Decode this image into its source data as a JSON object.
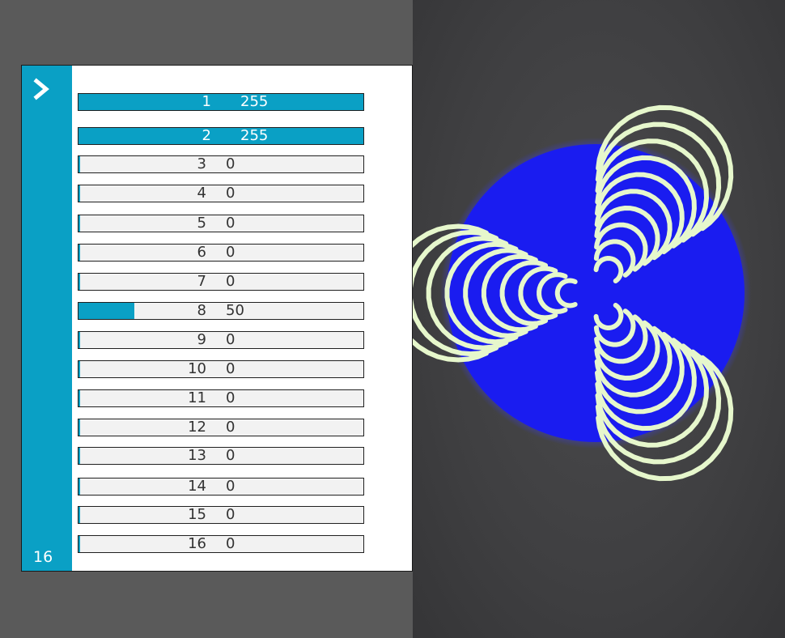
{
  "controls": {
    "expand_icon": "chevron-right-icon",
    "channel_count": "16"
  },
  "colors": {
    "accent": "#0aa0c5",
    "track": "#f2f2f2",
    "projection_blue": "#1a1cf0",
    "projection_lines": "#e6f7cc"
  },
  "channels": [
    {
      "label": "1",
      "value": "255",
      "level": 1.0
    },
    {
      "label": "2",
      "value": "255",
      "level": 1.0
    },
    {
      "label": "3",
      "value": "0",
      "level": 0
    },
    {
      "label": "4",
      "value": "0",
      "level": 0
    },
    {
      "label": "5",
      "value": "0",
      "level": 0
    },
    {
      "label": "6",
      "value": "0",
      "level": 0
    },
    {
      "label": "7",
      "value": "0",
      "level": 0
    },
    {
      "label": "8",
      "value": "50",
      "level": 0.196
    },
    {
      "label": "9",
      "value": "0",
      "level": 0
    },
    {
      "label": "10",
      "value": "0",
      "level": 0
    },
    {
      "label": "11",
      "value": "0",
      "level": 0
    },
    {
      "label": "12",
      "value": "0",
      "level": 0
    },
    {
      "label": "13",
      "value": "0",
      "level": 0
    },
    {
      "label": "14",
      "value": "0",
      "level": 0
    },
    {
      "label": "15",
      "value": "0",
      "level": 0
    },
    {
      "label": "16",
      "value": "0",
      "level": 0
    }
  ]
}
